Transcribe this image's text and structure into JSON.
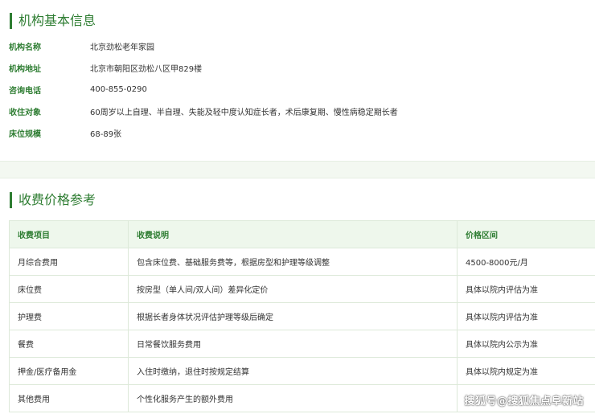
{
  "org_section": {
    "title": "机构基本信息",
    "rows": [
      {
        "label": "机构名称",
        "value": "北京劲松老年家园"
      },
      {
        "label": "机构地址",
        "value": "北京市朝阳区劲松八区甲829楼"
      },
      {
        "label": "咨询电话",
        "value": "400-855-0290"
      },
      {
        "label": "收住对象",
        "value": "60周岁以上自理、半自理、失能及轻中度认知症长者，术后康复期、慢性病稳定期长者"
      },
      {
        "label": "床位规模",
        "value": "68-89张"
      }
    ]
  },
  "price_section": {
    "title": "收费价格参考",
    "headers": [
      "收费项目",
      "收费说明",
      "价格区间"
    ],
    "rows": [
      [
        "月综合费用",
        "包含床位费、基础服务费等，根据房型和护理等级调整",
        "4500-8000元/月"
      ],
      [
        "床位费",
        "按房型（单人间/双人间）差异化定价",
        "具体以院内评估为准"
      ],
      [
        "护理费",
        "根据长者身体状况评估护理等级后确定",
        "具体以院内评估为准"
      ],
      [
        "餐费",
        "日常餐饮服务费用",
        "具体以院内公示为准"
      ],
      [
        "押金/医疗备用金",
        "入住时缴纳，退住时按规定结算",
        "具体以院内规定为准"
      ],
      [
        "其他费用",
        "个性化服务产生的额外费用",
        ""
      ]
    ]
  },
  "watermark": "搜狐号@搜狐焦点阜新站",
  "colors": {
    "accent": "#2e7d32",
    "header_bg": "#eef7ec",
    "border": "#dde9d9",
    "gap_bg": "#f3f8f1"
  }
}
